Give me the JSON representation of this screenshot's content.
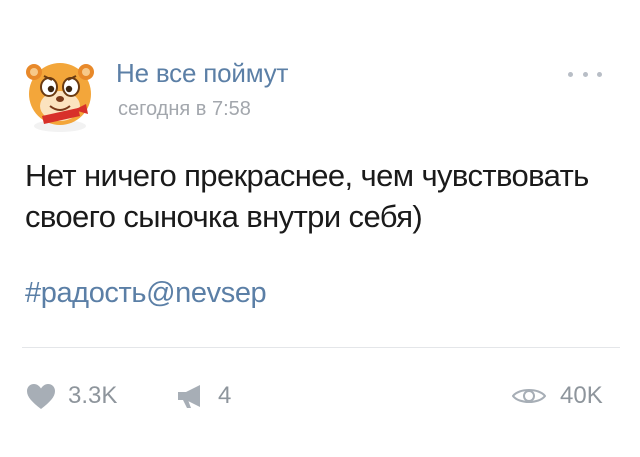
{
  "post": {
    "author": {
      "name": "Не все поймут",
      "avatar_icon": "cartoon-hamster-avatar"
    },
    "time": "сегодня в 7:58",
    "text_lines": [
      "Нет ничего прекраснее, чем чувствовать",
      "своего сыночка внутри себя)"
    ],
    "hashtag": "#радость@nevsep",
    "more_icon": "more-dots-icon"
  },
  "actions": {
    "likes": {
      "icon": "heart-icon",
      "count": "3.3K"
    },
    "shares": {
      "icon": "megaphone-icon",
      "count": "4"
    },
    "views": {
      "icon": "eye-icon",
      "count": "40K"
    }
  },
  "colors": {
    "link_blue": "#5b7fa6",
    "muted_gray": "#a3a7ad",
    "text_dark": "#1a1a1a",
    "icon_gray": "#b8bec6"
  }
}
